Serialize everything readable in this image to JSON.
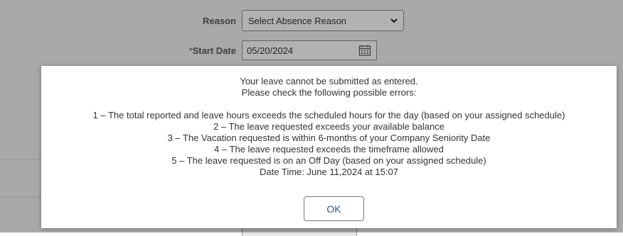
{
  "form": {
    "reason_label": "Reason",
    "reason_selected": "Select Absence Reason",
    "start_date_required_mark": "*",
    "start_date_label": "Start Date",
    "start_date_value": "05/20/2024"
  },
  "dialog": {
    "lines": [
      "Your leave cannot be submitted as entered.",
      "Please check the following possible errors:",
      "",
      "1 – The total reported and leave hours exceeds the scheduled hours for the day (based on your assigned schedule)",
      "2 – The leave requested exceeds your available balance",
      "3 – The Vacation requested is within 6-months of your Company Seniority Date",
      "4 – The leave requested exceeds the timeframe allowed",
      "5 – The leave requested is on an Off Day (based on your assigned schedule)",
      "Date Time: June 11,2024 at 15:07"
    ],
    "ok_label": "OK"
  },
  "icons": {
    "dropdown": "chevron-down-icon",
    "date_picker": "calendar-icon"
  }
}
